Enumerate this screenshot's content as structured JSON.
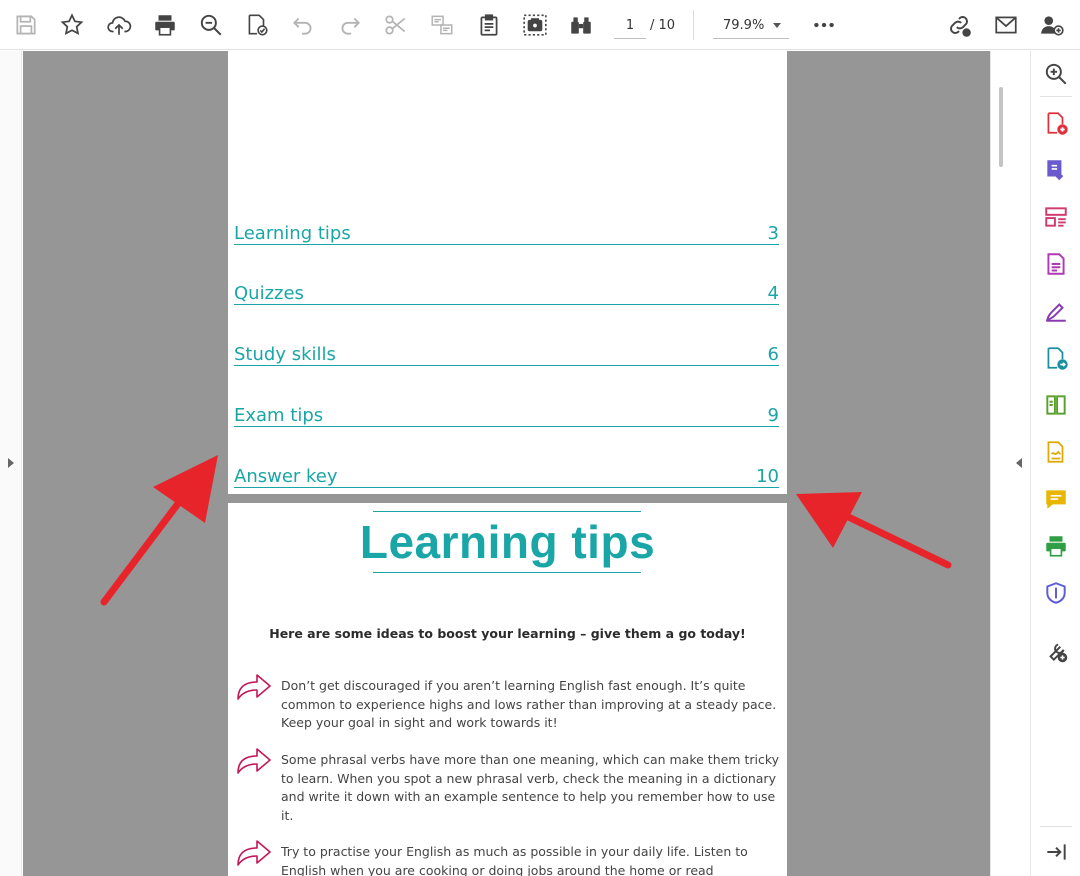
{
  "toolbar": {
    "current_page": "1",
    "total_pages": "/ 10",
    "zoom": "79.9%"
  },
  "toc": [
    {
      "title": "Learning tips",
      "page": "3"
    },
    {
      "title": "Quizzes",
      "page": "4"
    },
    {
      "title": "Study skills",
      "page": "6"
    },
    {
      "title": "Exam tips",
      "page": "9"
    },
    {
      "title": "Answer key",
      "page": "10"
    }
  ],
  "page2": {
    "title": "Learning tips",
    "intro": "Here are some ideas to boost your learning – give them a go today!",
    "tips": [
      "Don’t get discouraged if you aren’t learning English fast enough. It’s quite common to experience highs and lows rather than improving at a steady pace. Keep your goal in sight and work towards it!",
      "Some phrasal verbs have more than one meaning, which can make them tricky to learn. When you spot a new phrasal verb, check the meaning in a dictionary and write it down with an example sentence to help you remember how to use it.",
      "Try to practise your English as much as possible in your daily life. Listen to English when you are cooking or doing jobs around the home or read"
    ]
  },
  "colors": {
    "accent": "#1aa6a6",
    "arrow": "#e8242b",
    "tip_icon": "#c2185b"
  }
}
